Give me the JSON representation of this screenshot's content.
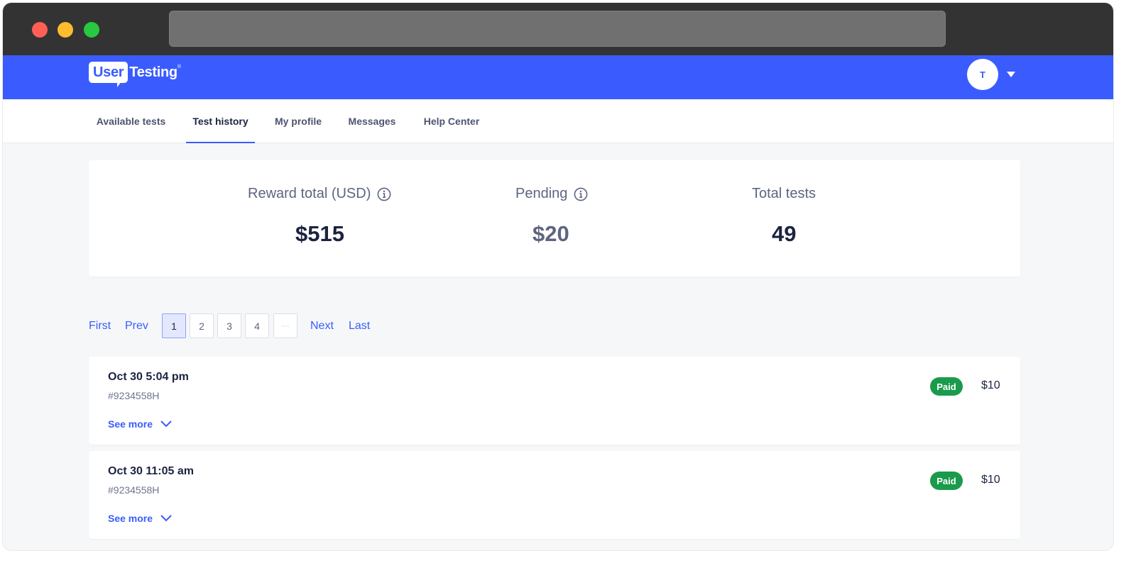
{
  "brand": {
    "logo_box": "User",
    "logo_text": "Testing",
    "logo_mark": "®",
    "primary_color": "#3a5cff",
    "success_color": "#1a9b4b"
  },
  "user": {
    "avatar_initial": "T"
  },
  "tabs": [
    {
      "label": "Available tests",
      "active": false
    },
    {
      "label": "Test history",
      "active": true
    },
    {
      "label": "My profile",
      "active": false
    },
    {
      "label": "Messages",
      "active": false
    },
    {
      "label": "Help Center",
      "active": false
    }
  ],
  "summary": {
    "reward_total": {
      "label": "Reward total (USD)",
      "value": "$515",
      "icon": "info-icon"
    },
    "pending": {
      "label": "Pending",
      "value": "$20",
      "icon": "info-icon"
    },
    "total_tests": {
      "label": "Total tests",
      "value": "49"
    }
  },
  "pagination": {
    "first": "First",
    "prev": "Prev",
    "pages": [
      "1",
      "2",
      "3",
      "4"
    ],
    "ellipsis": "···",
    "current": "1",
    "next": "Next",
    "last": "Last"
  },
  "tests": [
    {
      "date": "Oct 30 5:04 pm",
      "id": "#9234558H",
      "see_more": "See more",
      "status": "Paid",
      "amount": "$10"
    },
    {
      "date": "Oct 30 11:05 am",
      "id": "#9234558H",
      "see_more": "See more",
      "status": "Paid",
      "amount": "$10"
    }
  ]
}
